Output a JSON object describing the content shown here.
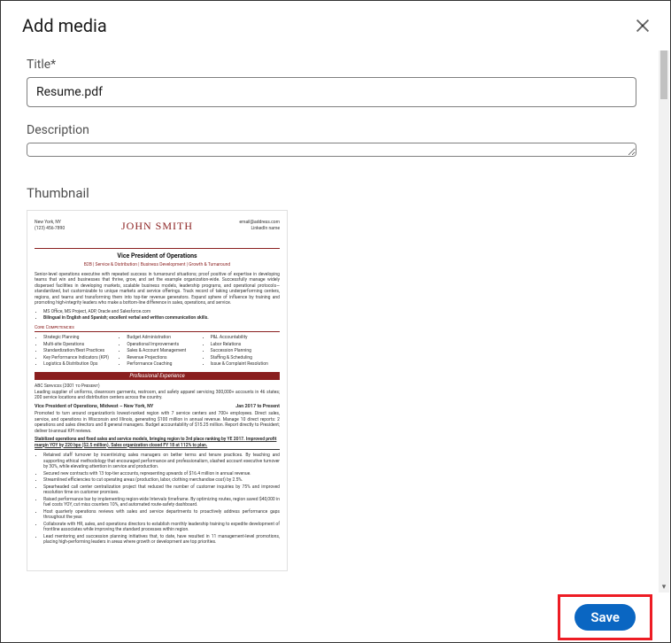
{
  "modal": {
    "title": "Add media"
  },
  "fields": {
    "title_label": "Title*",
    "title_value": "Resume.pdf",
    "description_label": "Description",
    "description_value": "",
    "thumbnail_label": "Thumbnail"
  },
  "thumbnail": {
    "name": "JOHN SMITH",
    "location": "New York, NY",
    "phone": "(123) 456-7890",
    "email": "email@address.com",
    "linkedin": "LinkedIn name",
    "headline": "Vice President of Operations",
    "tagline": "B2B | Service & Distribution | Business Development | Growth & Turnaround",
    "summary": "Senior-level operations executive with repeated success in turnaround situations; proof positive of expertise in developing teams that win and businesses that thrive, grow, and set the example organization-wide. Successfully manage widely dispersed facilities in developing markets, scalable business models, leadership programs, and operational protocols—standardized, but customizable to unique markets and service offerings. Track record of taking underperforming centers, regions, and teams and transforming them into top-tier revenue generators. Expand sphere of influence by training and promoting high-integrity leaders who make a bottom-line difference in sales, operations, and service.",
    "skills_line1": "MS Office, MS Project, ADP, Oracle and Salesforce.com",
    "skills_line2": "Bilingual in English and Spanish; excellent verbal and written communication skills.",
    "core_header": "Core Competencies",
    "competencies_col1": [
      "Strategic Planning",
      "Multi-site Operations",
      "Standardization/Best Practices",
      "Key Performance Indicators (KPI)",
      "Logistics & Distribution Ops"
    ],
    "competencies_col2": [
      "Budget Administration",
      "Operational Improvements",
      "Sales & Account Management",
      "Revenue Projections",
      "Performance Coaching"
    ],
    "competencies_col3": [
      "P&L Accountability",
      "Labor Relations",
      "Succession Planning",
      "Staffing & Scheduling",
      "Issue & Complaint Resolution"
    ],
    "experience_header": "Professional Experience",
    "company": "ABC Services (2001 to Present)",
    "company_desc": "Leading supplier of uniforms, cleanroom garments, restroom, and safety apparel servicing 300,000+ accounts in 46 states; 200 service locations and distribution centers across the country.",
    "job_title": "Vice President of Operations, Midwest – New York, NY",
    "job_dates": "Jan 2017 to Present",
    "job_desc": "Promoted to turn around organization's lowest-ranked region with 7 service centers and 700+ employees. Direct sales, service, and operations in Wisconsin and Illinois, generating $100 million in annual revenue. Manage 10 direct reports: 2 operations and sales directors and 8 general managers. Budget accountability of $15.25 million. Report directly to President; deliver bi-annual KPI reviews.",
    "job_bold": "Stabilized operations and fixed sales and service models, bringing region to 3rd place ranking by YE 2017. Improved profit margin YOY by 220 bps ($2.5 million). Sales organization closed FY 18 at 112% to plan.",
    "job_bullets": [
      "Retained staff turnover by incentivizing sales managers on better terms and tenure practices. By teaching and supporting ethical methodology that encouraged performance and professionalism, slashed account executive turnover by 30%, while elevating attention in service and production.",
      "Secured new contracts with 13 top-tier accounts, representing upwards of $16.4 million in annual revenue.",
      "Streamlined efficiencies to cut operating areas (production, labor, clothing merchandise cost) by 2.5%.",
      "Spearheaded call center centralization project that reduced the number of customer inquiries by 75% and improved resolution time on customer promises.",
      "Raised performance bar by implementing region-wide Intervals timeframe. By optimizing routes, region saved $40,000 in fuel costs YOY, cut miss counters 10%, and automated route-safety dashboard.",
      "Host quarterly operations reviews with sales and service departments to proactively address performance gaps throughout the year.",
      "Collaborate with HR, sales, and operations directors to establish monthly leadership training to expedite development of frontline associates while improving the standard processes within region.",
      "Lead mentoring and succession planning initiatives that, to date, have resulted in 11 management-level promotions, placing high-performing leaders in areas where growth or development are top priorities."
    ]
  },
  "footer": {
    "save_label": "Save"
  }
}
